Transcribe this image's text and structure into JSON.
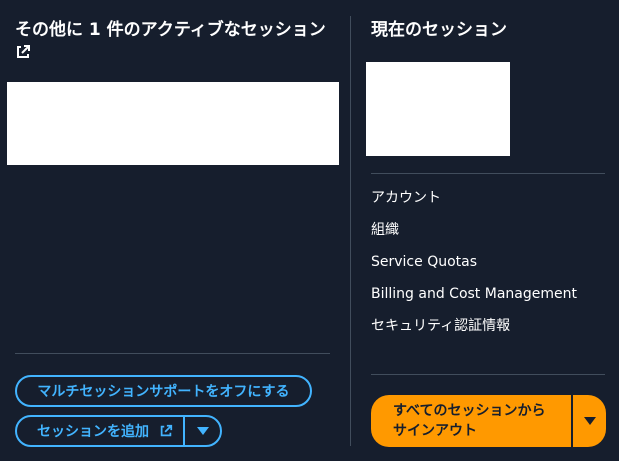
{
  "left_panel": {
    "title": "その他に 1 件のアクティブなセッション",
    "multi_session_button": "マルチセッションサポートをオフにする",
    "add_session_button": "セッションを追加"
  },
  "right_panel": {
    "title": "現在のセッション",
    "menu": [
      {
        "label": "アカウント"
      },
      {
        "label": "組織"
      },
      {
        "label": "Service Quotas"
      },
      {
        "label": "Billing and Cost Management"
      },
      {
        "label": "セキュリティ認証情報"
      }
    ],
    "sign_out_button": {
      "line1": "すべてのセッションから",
      "line2": "サインアウト"
    }
  },
  "icons": {
    "external": "external-link-icon",
    "dropdown": "caret-down-icon"
  },
  "colors": {
    "background": "#161e2d",
    "link_blue": "#42b4ff",
    "primary_orange": "#ff9900",
    "divider": "#414d5c"
  }
}
